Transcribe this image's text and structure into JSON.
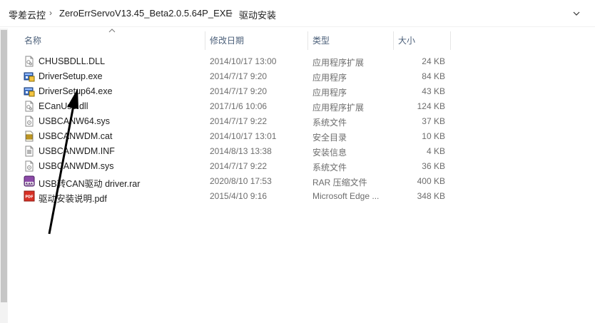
{
  "breadcrumb": {
    "items": [
      "零差云控",
      "ZeroErrServoV13.45_Beta2.0.5.64P_EXE",
      "驱动安装"
    ],
    "separator": "›"
  },
  "columns": {
    "name": "名称",
    "date": "修改日期",
    "type": "类型",
    "size": "大小"
  },
  "files": [
    {
      "name": "CHUSBDLL.DLL",
      "date": "2014/10/17 13:00",
      "type": "应用程序扩展",
      "size": "24 KB",
      "icon": "dll-icon"
    },
    {
      "name": "DriverSetup.exe",
      "date": "2014/7/17 9:20",
      "type": "应用程序",
      "size": "84 KB",
      "icon": "exe-icon"
    },
    {
      "name": "DriverSetup64.exe",
      "date": "2014/7/17 9:20",
      "type": "应用程序",
      "size": "43 KB",
      "icon": "exe-icon"
    },
    {
      "name": "ECanUsb.dll",
      "date": "2017/1/6 10:06",
      "type": "应用程序扩展",
      "size": "124 KB",
      "icon": "dll-icon"
    },
    {
      "name": "USBCANW64.sys",
      "date": "2014/7/17 9:22",
      "type": "系统文件",
      "size": "37 KB",
      "icon": "sys-icon"
    },
    {
      "name": "USBCANWDM.cat",
      "date": "2014/10/17 13:01",
      "type": "安全目录",
      "size": "10 KB",
      "icon": "cat-icon"
    },
    {
      "name": "USBCANWDM.INF",
      "date": "2014/8/13 13:38",
      "type": "安装信息",
      "size": "4 KB",
      "icon": "inf-icon"
    },
    {
      "name": "USBCANWDM.sys",
      "date": "2014/7/17 9:22",
      "type": "系统文件",
      "size": "36 KB",
      "icon": "sys-icon"
    },
    {
      "name": "USB转CAN驱动 driver.rar",
      "date": "2020/8/10 17:53",
      "type": "RAR 压缩文件",
      "size": "400 KB",
      "icon": "rar-icon"
    },
    {
      "name": "驱动安装说明.pdf",
      "date": "2015/4/10 9:16",
      "type": "Microsoft Edge ...",
      "size": "348 KB",
      "icon": "pdf-icon"
    }
  ],
  "annotation_arrow_color": "#000000"
}
